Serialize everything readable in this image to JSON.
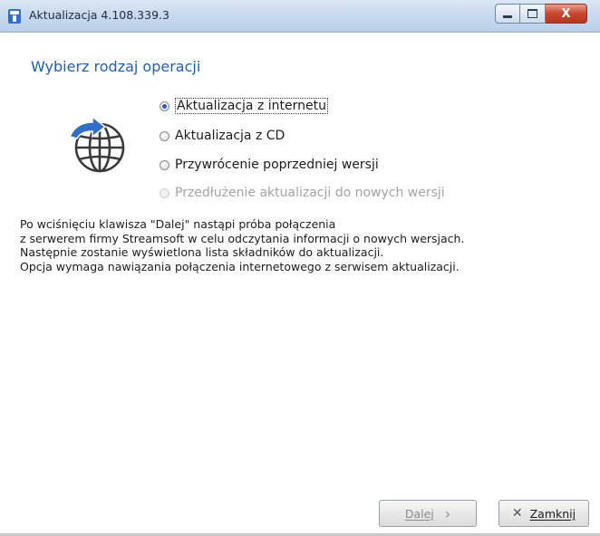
{
  "window": {
    "title": "Aktualizacja 4.108.339.3",
    "close_glyph": "X"
  },
  "heading": "Wybierz rodzaj operacji",
  "icon": "globe-refresh-icon",
  "options": [
    {
      "label": "Aktualizacja z internetu",
      "checked": true,
      "enabled": true
    },
    {
      "label": "Aktualizacja z CD",
      "checked": false,
      "enabled": true
    },
    {
      "label": "Przywrócenie poprzedniej wersji",
      "checked": false,
      "enabled": true
    },
    {
      "label": "Przedłużenie aktualizacji do nowych wersji",
      "checked": false,
      "enabled": false
    }
  ],
  "info": [
    "Po wciśnięciu klawisza \"Dalej\" nastąpi próba połączenia",
    "z serwerem firmy Streamsoft w celu odczytania informacji o nowych wersjach.",
    "Następnie zostanie wyświetlona lista składników do aktualizacji.",
    "Opcja wymaga nawiązania połączenia internetowego z serwisem aktualizacji."
  ],
  "buttons": {
    "next_label": "Dalej",
    "next_glyph": "›",
    "close_label": "Zamknij",
    "close_glyph": "✕"
  },
  "colors": {
    "heading": "#1a60b6",
    "titlebar": "#c6d8ee",
    "icon_arrow": "#2f6fc8"
  }
}
